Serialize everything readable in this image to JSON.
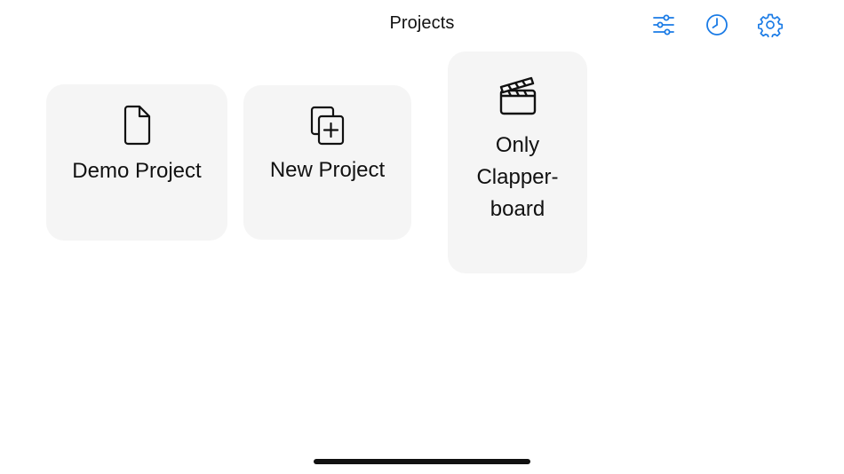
{
  "header": {
    "title": "Projects",
    "actions": [
      {
        "icon": "sliders-icon",
        "label": "Filter"
      },
      {
        "icon": "clock-icon",
        "label": "History"
      },
      {
        "icon": "gear-icon",
        "label": "Settings"
      }
    ]
  },
  "projects": [
    {
      "label": "Demo Project",
      "icon": "document-icon"
    },
    {
      "label": "New Project",
      "icon": "add-document-icon"
    },
    {
      "label_lines": [
        "Only",
        "Clapper-",
        "board"
      ],
      "icon": "clapperboard-icon"
    }
  ],
  "colors": {
    "accent": "#1a7be6",
    "card_background": "#f5f5f5",
    "text": "#111111"
  }
}
